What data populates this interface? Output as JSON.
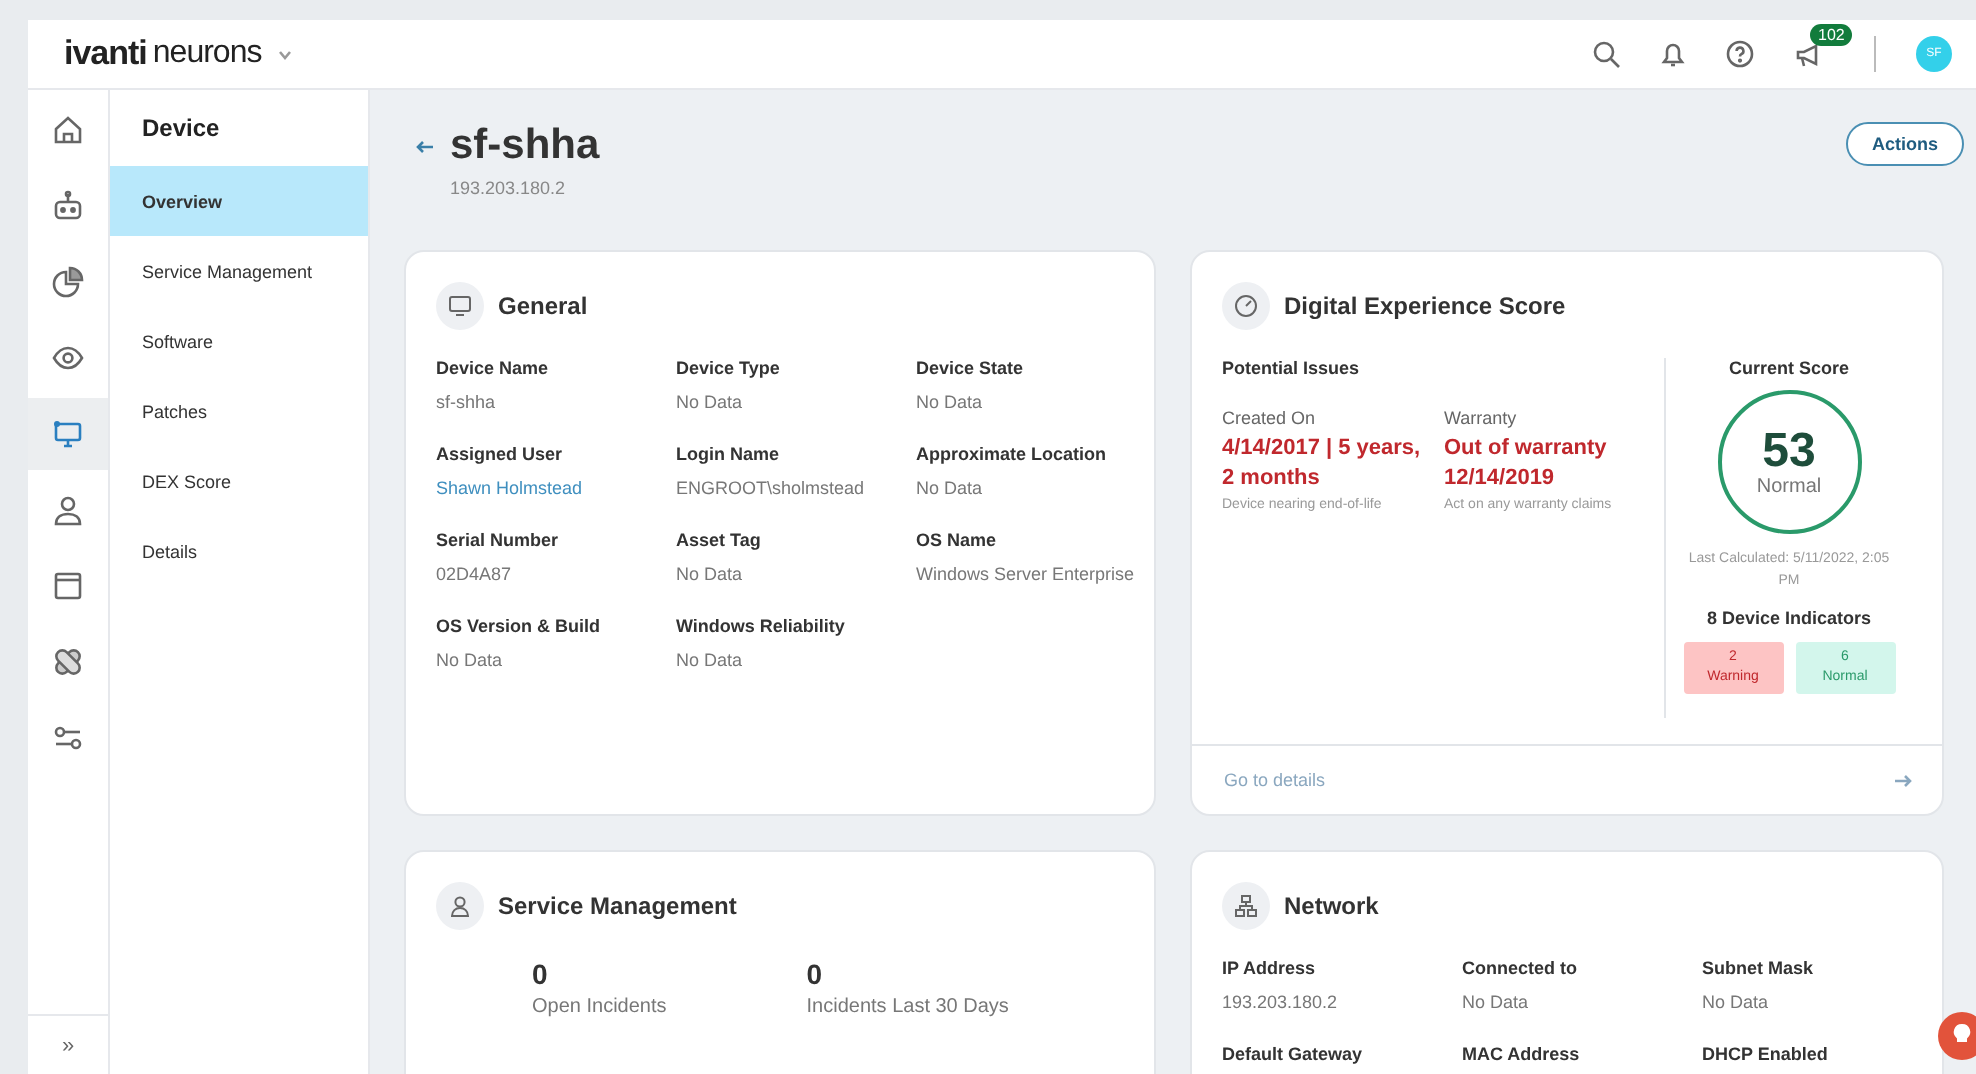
{
  "header": {
    "brand": "ivanti",
    "product": "neurons",
    "badge": "102",
    "avatar": "SF"
  },
  "rail": {
    "items": [
      {
        "kind": "home",
        "selected": false
      },
      {
        "kind": "robot",
        "selected": false
      },
      {
        "kind": "pie",
        "selected": false
      },
      {
        "kind": "eye",
        "selected": false
      },
      {
        "kind": "monitor",
        "selected": true
      },
      {
        "kind": "person",
        "selected": false
      },
      {
        "kind": "window",
        "selected": false
      },
      {
        "kind": "bandage",
        "selected": false
      },
      {
        "kind": "sliders",
        "selected": false
      }
    ],
    "expand": "»"
  },
  "subnav": {
    "title": "Device",
    "items": [
      {
        "label": "Overview",
        "selected": true
      },
      {
        "label": "Service Management",
        "selected": false
      },
      {
        "label": "Software",
        "selected": false
      },
      {
        "label": "Patches",
        "selected": false
      },
      {
        "label": "DEX Score",
        "selected": false
      },
      {
        "label": "Details",
        "selected": false
      }
    ]
  },
  "page": {
    "title": "sf-shha",
    "subtitle": "193.203.180.2",
    "action": "Actions"
  },
  "general": {
    "title": "General",
    "fields": [
      {
        "label": "Device Name",
        "value": "sf-shha",
        "link": false
      },
      {
        "label": "Device Type",
        "value": "No Data",
        "link": false
      },
      {
        "label": "Device State",
        "value": "No Data",
        "link": false
      },
      {
        "label": "Assigned User",
        "value": "Shawn Holmstead",
        "link": true
      },
      {
        "label": "Login Name",
        "value": "ENGROOT\\sholmstead",
        "link": false
      },
      {
        "label": "Approximate Location",
        "value": "No Data",
        "link": false
      },
      {
        "label": "Serial Number",
        "value": "02D4A87",
        "link": false
      },
      {
        "label": "Asset Tag",
        "value": "No Data",
        "link": false
      },
      {
        "label": "OS Name",
        "value": "Windows Server Enterprise",
        "link": false
      },
      {
        "label": "OS Version & Build",
        "value": "No Data",
        "link": false
      },
      {
        "label": "Windows Reliability",
        "value": "No Data",
        "link": false
      }
    ]
  },
  "dex": {
    "title": "Digital Experience Score",
    "issues_title": "Potential Issues",
    "issues": [
      {
        "label": "Created On",
        "value": "4/14/2017 | 5 years, 2 months",
        "note": "Device nearing end-of-life"
      },
      {
        "label": "Warranty",
        "value": "Out of warranty 12/14/2019",
        "note": "Act on any warranty claims"
      }
    ],
    "score_title": "Current Score",
    "score": "53",
    "score_status": "Normal",
    "last_calculated": "Last Calculated: 5/11/2022, 2:05 PM",
    "indicators_title": "8 Device Indicators",
    "indicators": [
      {
        "count": "2",
        "label": "Warning",
        "color": "#fdc4c4"
      },
      {
        "count": "6",
        "label": "Normal",
        "color": "#d3f6ec"
      }
    ],
    "footer": "Go to details"
  },
  "service": {
    "title": "Service Management",
    "stats": [
      {
        "value": "0",
        "label": "Open Incidents"
      },
      {
        "value": "0",
        "label": "Incidents Last 30 Days"
      }
    ]
  },
  "network": {
    "title": "Network",
    "fields": [
      {
        "label": "IP Address",
        "value": "193.203.180.2"
      },
      {
        "label": "Connected to",
        "value": "No Data"
      },
      {
        "label": "Subnet Mask",
        "value": "No Data"
      },
      {
        "label": "Default Gateway"
      },
      {
        "label": "MAC Address"
      },
      {
        "label": "DHCP Enabled"
      }
    ]
  }
}
